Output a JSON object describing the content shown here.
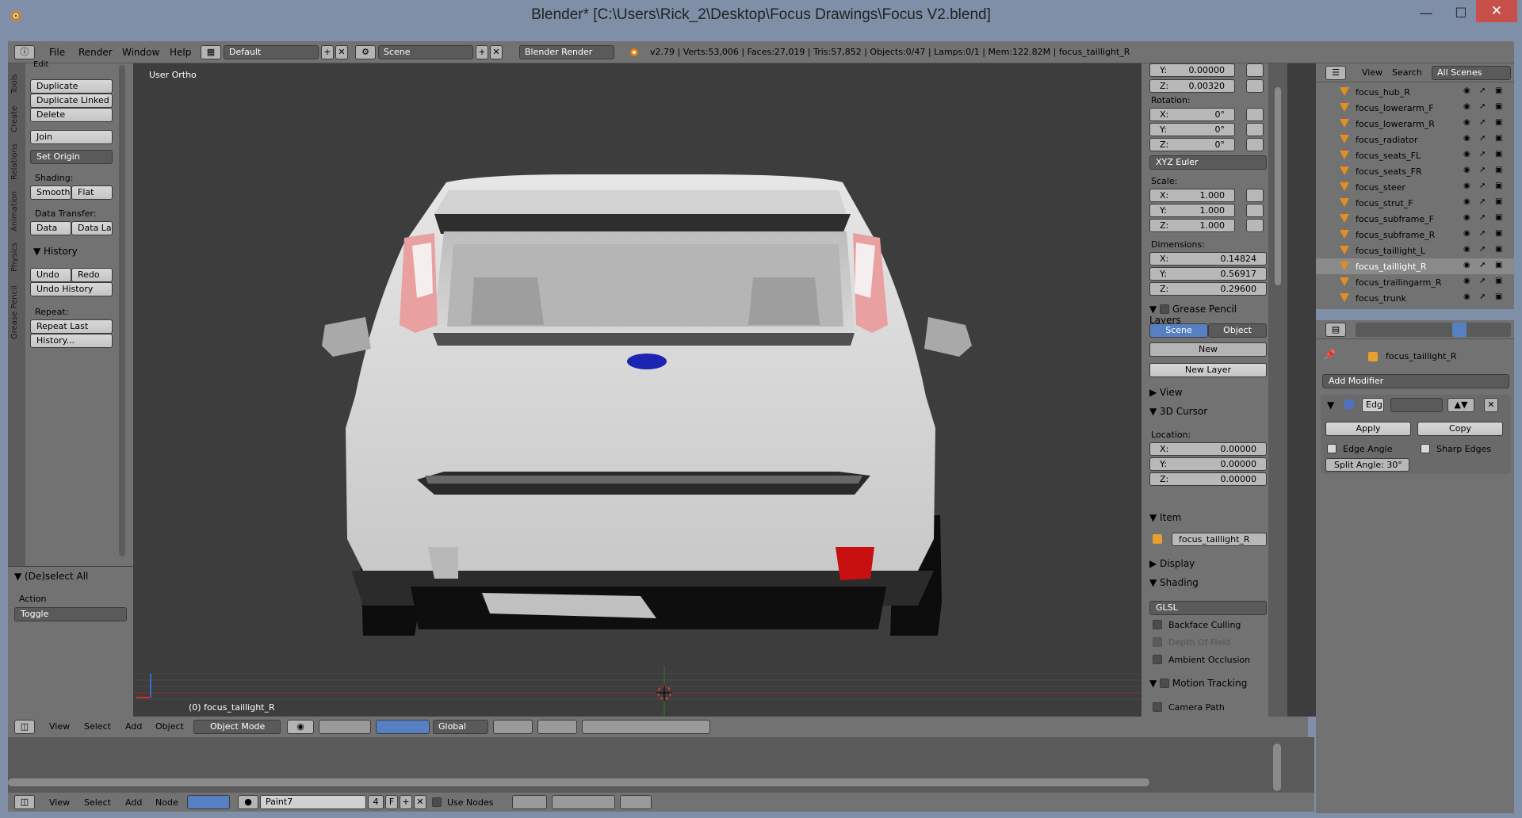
{
  "window": {
    "title": "Blender* [C:\\Users\\Rick_2\\Desktop\\Focus Drawings\\Focus V2.blend]",
    "minimize": "—",
    "maximize": "☐",
    "close": "✕"
  },
  "info_header": {
    "menus": [
      "File",
      "Render",
      "Window",
      "Help"
    ],
    "layout": "Default",
    "scene": "Scene",
    "engine": "Blender Render",
    "stats": "v2.79 | Verts:53,006 | Faces:27,019 | Tris:57,852 | Objects:0/47 | Lamps:0/1 | Mem:122.82M | focus_taillight_R"
  },
  "tool_shelf": {
    "tabs": [
      "Tools",
      "Create",
      "Relations",
      "Animation",
      "Physics",
      "Grease Pencil"
    ],
    "edit_header": "Edit",
    "duplicate": "Duplicate",
    "duplicate_linked": "Duplicate Linked",
    "delete": "Delete",
    "join": "Join",
    "set_origin": "Set Origin",
    "shading_label": "Shading:",
    "smooth": "Smooth",
    "flat": "Flat",
    "data_transfer_label": "Data Transfer:",
    "data": "Data",
    "data_layout": "Data La",
    "history_header": "History",
    "undo": "Undo",
    "redo": "Redo",
    "undo_history": "Undo History",
    "repeat_label": "Repeat:",
    "repeat_last": "Repeat Last",
    "history_dots": "History...",
    "operator_header": "(De)select All",
    "action_label": "Action",
    "action_value": "Toggle"
  },
  "viewport": {
    "view_label": "User Ortho",
    "object_label": "(0) focus_taillight_R"
  },
  "properties_panel": {
    "loc_y": "0.00000",
    "loc_z": "0.00320",
    "rotation_label": "Rotation:",
    "rot": [
      {
        "k": "X:",
        "v": "0°"
      },
      {
        "k": "Y:",
        "v": "0°"
      },
      {
        "k": "Z:",
        "v": "0°"
      }
    ],
    "rotation_mode": "XYZ Euler",
    "scale_label": "Scale:",
    "scale": [
      {
        "k": "X:",
        "v": "1.000"
      },
      {
        "k": "Y:",
        "v": "1.000"
      },
      {
        "k": "Z:",
        "v": "1.000"
      }
    ],
    "dimensions_label": "Dimensions:",
    "dims": [
      {
        "k": "X:",
        "v": "0.14824"
      },
      {
        "k": "Y:",
        "v": "0.56917"
      },
      {
        "k": "Z:",
        "v": "0.29600"
      }
    ],
    "grease_pencil_header": "Grease Pencil Layers",
    "gp_scene": "Scene",
    "gp_object": "Object",
    "gp_new": "New",
    "gp_new_layer": "New Layer",
    "view_header": "View",
    "cursor_header": "3D Cursor",
    "location_label": "Location:",
    "cursor": [
      {
        "k": "X:",
        "v": "0.00000"
      },
      {
        "k": "Y:",
        "v": "0.00000"
      },
      {
        "k": "Z:",
        "v": "0.00000"
      }
    ],
    "item_header": "Item",
    "item_name": "focus_taillight_R",
    "display_header": "Display",
    "shading_header": "Shading",
    "shading_mode": "GLSL",
    "backface": "Backface Culling",
    "dof": "Depth Of Field",
    "ao": "Ambient Occlusion",
    "motion_header": "Motion Tracking",
    "camera_path": "Camera Path"
  },
  "outliner": {
    "view": "View",
    "search": "Search",
    "all_scenes": "All Scenes",
    "items": [
      "focus_hub_R",
      "focus_lowerarm_F",
      "focus_lowerarm_R",
      "focus_radiator",
      "focus_seats_FL",
      "focus_seats_FR",
      "focus_steer",
      "focus_strut_F",
      "focus_subframe_F",
      "focus_subframe_R",
      "focus_taillight_L",
      "focus_taillight_R",
      "focus_trailingarm_R",
      "focus_trunk"
    ],
    "selected": "focus_taillight_R"
  },
  "modifier_panel": {
    "object_name": "focus_taillight_R",
    "add_modifier": "Add Modifier",
    "mod_name": "Edg",
    "apply": "Apply",
    "copy": "Copy",
    "edge_angle": "Edge Angle",
    "sharp_edges": "Sharp Edges",
    "split_angle": "Split Angle: 30°"
  },
  "view3d_header": {
    "menus": [
      "View",
      "Select",
      "Add",
      "Object"
    ],
    "mode": "Object Mode",
    "orientation": "Global"
  },
  "node_header": {
    "menus": [
      "View",
      "Select",
      "Add",
      "Node"
    ],
    "material": "Paint7",
    "users": "4",
    "fake": "F",
    "use_nodes": "Use Nodes"
  },
  "colors": {
    "panel": "#727272",
    "viewport": "#3d3d3d",
    "selected_blue": "#5680c2",
    "accent_red": "#c81010",
    "badge_blue": "#1c24b4"
  }
}
